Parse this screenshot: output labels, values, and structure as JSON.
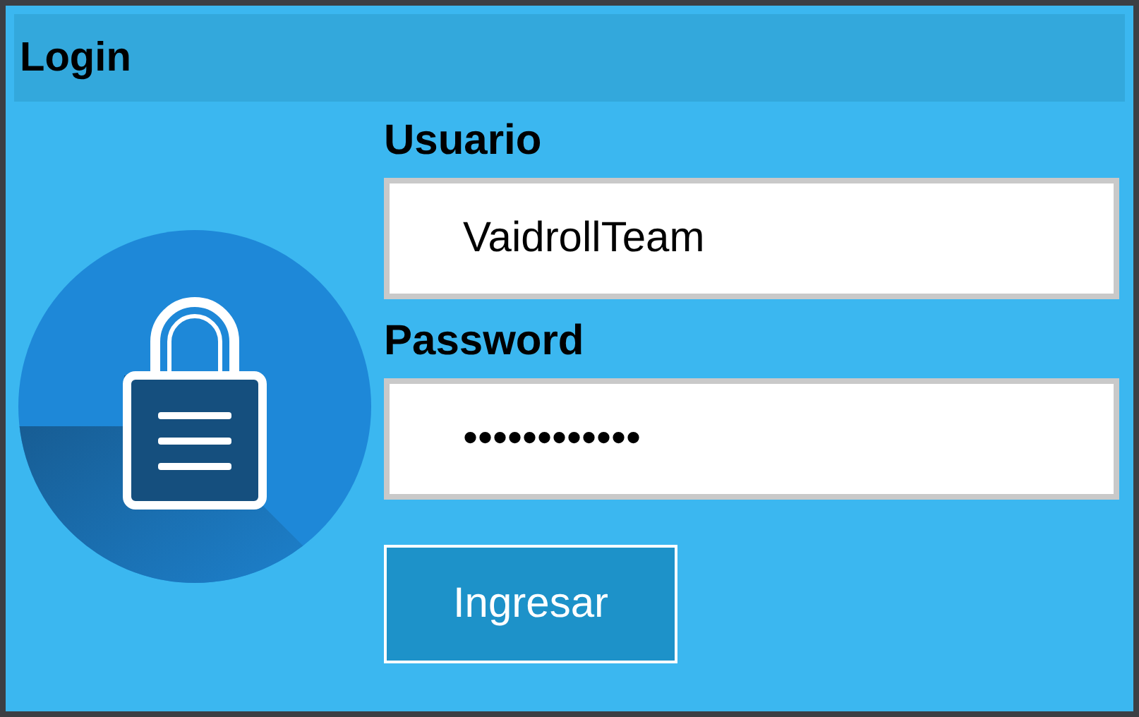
{
  "header": {
    "title": "Login"
  },
  "fields": [
    {
      "label": "Usuario",
      "value": "VaidrollTeam"
    },
    {
      "label": "Password",
      "value": "••••••••••••"
    }
  ],
  "button": {
    "label": "Ingresar"
  }
}
